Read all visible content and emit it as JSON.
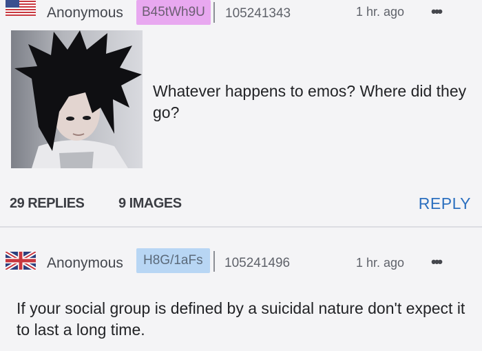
{
  "post1": {
    "flag": "us-flag-icon",
    "author": "Anonymous",
    "poster_id": "B45tWh9U",
    "post_number": "105241343",
    "time": "1 hr. ago",
    "menu": "•••",
    "image": "emo-portrait-thumbnail",
    "text": "Whatever happens to emos? Where did they go?",
    "replies": "29 REPLIES",
    "images": "9 IMAGES",
    "reply_label": "REPLY"
  },
  "post2": {
    "flag": "uk-flag-icon",
    "author": "Anonymous",
    "poster_id": "H8G/1aFs",
    "post_number": "105241496",
    "time": "1 hr. ago",
    "menu": "•••",
    "text": "If your social group is defined by a suicidal nature don't expect it to last a long time."
  },
  "colors": {
    "background": "#f4f4f6",
    "id_badge_1": "#e8a8f0",
    "id_badge_2": "#b8d6f4",
    "reply_link": "#2b6fbf"
  }
}
